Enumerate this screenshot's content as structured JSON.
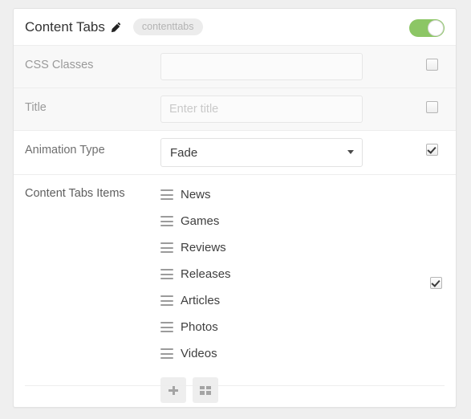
{
  "panel": {
    "title": "Content Tabs",
    "edit_icon": "pencil-icon",
    "badge": "contenttabs",
    "enabled_toggle": {
      "state": "on",
      "color": "#8cc665"
    }
  },
  "rows": [
    {
      "label": "CSS Classes",
      "type": "text",
      "value": "",
      "placeholder": "",
      "checked": false,
      "disabled": true
    },
    {
      "label": "Title",
      "type": "text",
      "value": "",
      "placeholder": "Enter title",
      "checked": false,
      "disabled": true
    },
    {
      "label": "Animation Type",
      "type": "select",
      "value": "Fade",
      "options": [
        "Fade"
      ],
      "checked": true,
      "disabled": false
    }
  ],
  "items_section": {
    "label": "Content Tabs Items",
    "checked": true,
    "items": [
      {
        "label": "News",
        "handle_icon": "drag-handle-icon"
      },
      {
        "label": "Games",
        "handle_icon": "drag-handle-icon"
      },
      {
        "label": "Reviews",
        "handle_icon": "drag-handle-icon"
      },
      {
        "label": "Releases",
        "handle_icon": "drag-handle-icon"
      },
      {
        "label": "Articles",
        "handle_icon": "drag-handle-icon"
      },
      {
        "label": "Photos",
        "handle_icon": "drag-handle-icon"
      },
      {
        "label": "Videos",
        "handle_icon": "drag-handle-icon"
      }
    ],
    "buttons": [
      {
        "icon": "plus-icon",
        "name": "add-item-button"
      },
      {
        "icon": "grid-icon",
        "name": "bulk-edit-button"
      }
    ]
  }
}
